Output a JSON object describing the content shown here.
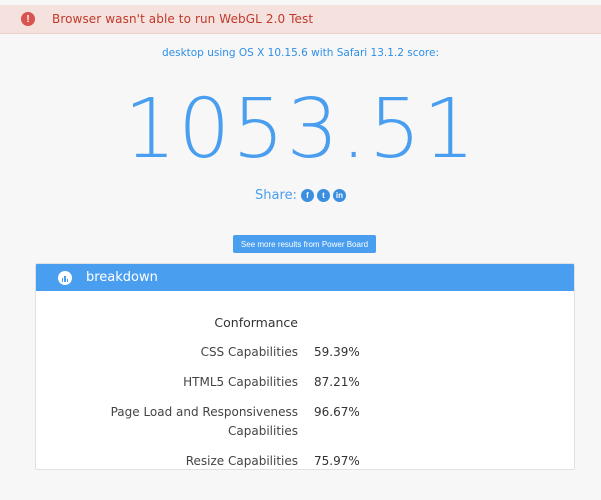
{
  "alert": {
    "icon": "exclamation-icon",
    "icon_glyph": "!",
    "message": "Browser wasn't able to run WebGL 2.0 Test"
  },
  "header": {
    "subtitle": "desktop using OS X 10.15.6 with Safari 13.1.2 score:",
    "score": "1053.51"
  },
  "share": {
    "label": "Share:",
    "networks": [
      {
        "name": "facebook-icon",
        "glyph": "f"
      },
      {
        "name": "twitter-icon",
        "glyph": "t"
      },
      {
        "name": "linkedin-icon",
        "glyph": "in"
      }
    ]
  },
  "more_button": {
    "label": "See more results from Power Board"
  },
  "breakdown": {
    "title": "breakdown",
    "icon": "bar-chart-icon",
    "section": "Conformance",
    "rows": [
      {
        "label": "CSS Capabilities",
        "value": "59.39%"
      },
      {
        "label": "HTML5 Capabilities",
        "value": "87.21%"
      },
      {
        "label": "Page Load and Responsiveness Capabilities",
        "value": "96.67%"
      },
      {
        "label": "Resize Capabilities",
        "value": "75.97%"
      }
    ]
  },
  "colors": {
    "accent": "#4a9eef",
    "alert_bg": "#f5e1de",
    "alert_text": "#c0392b"
  }
}
